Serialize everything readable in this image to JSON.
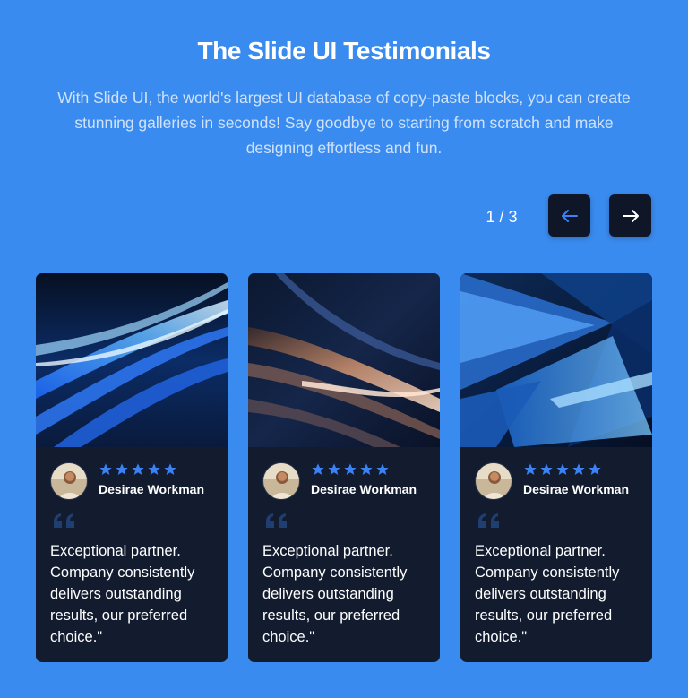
{
  "header": {
    "title": "The Slide UI Testimonials",
    "subtitle": "With Slide UI, the world's largest UI database of copy-paste blocks, you can create stunning galleries in seconds! Say goodbye to starting from scratch and make designing effortless and fun."
  },
  "pagination": {
    "indicator": "1 / 3",
    "prev_icon": "arrow-left-icon",
    "next_icon": "arrow-right-icon"
  },
  "colors": {
    "background": "#3a8bef",
    "card": "#131b2e",
    "star": "#3b82f6",
    "prev_arrow": "#3b82f6",
    "next_arrow": "#ffffff"
  },
  "testimonials": [
    {
      "image": "abstract-blue-streaks-image",
      "avatar": "user-avatar-photo",
      "rating": 5,
      "name": "Desirae Workman",
      "quote": "Exceptional partner. Company consistently delivers outstanding results, our preferred choice.\""
    },
    {
      "image": "abstract-bronze-streaks-image",
      "avatar": "user-avatar-photo",
      "rating": 5,
      "name": "Desirae Workman",
      "quote": "Exceptional partner. Company consistently delivers outstanding results, our preferred choice.\""
    },
    {
      "image": "abstract-blue-shards-image",
      "avatar": "user-avatar-photo",
      "rating": 5,
      "name": "Desirae Workman",
      "quote": "Exceptional partner. Company consistently delivers outstanding results, our preferred choice.\""
    }
  ]
}
